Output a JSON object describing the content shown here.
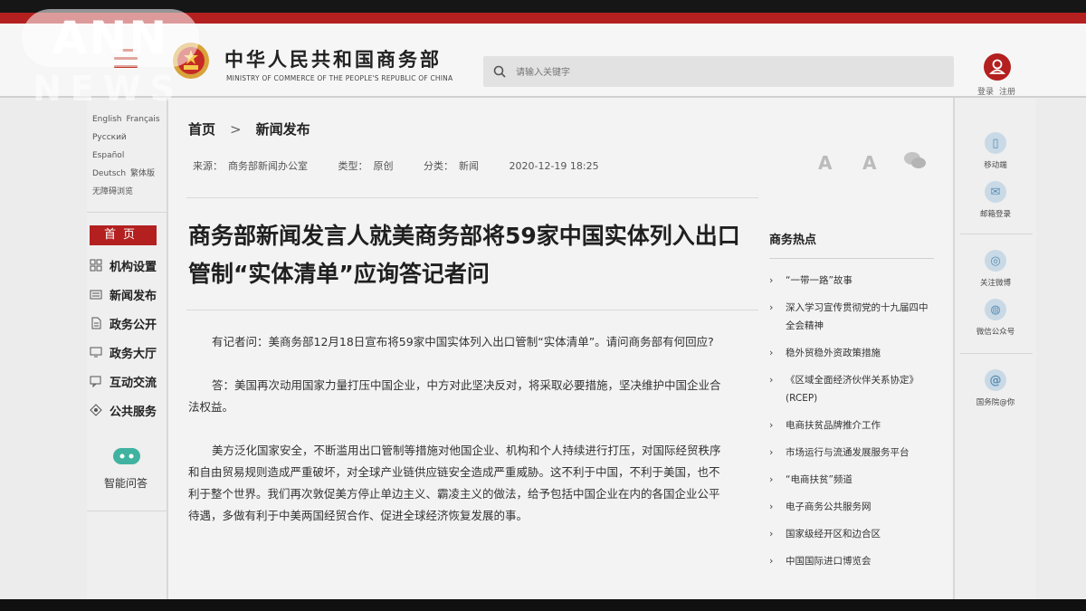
{
  "watermark": {
    "top": "ANN",
    "bottom": "NEWS"
  },
  "header": {
    "ministry_cn": "中华人民共和国商务部",
    "ministry_en": "MINISTRY OF COMMERCE OF THE PEOPLE'S REPUBLIC OF CHINA",
    "search_placeholder": "请输入关键字",
    "login": "登录",
    "register": "注册"
  },
  "left_nav": {
    "languages": [
      "English",
      "Français",
      "Русский",
      "Español",
      "Deutsch",
      "繁体版",
      "无障碍浏览"
    ],
    "home": "首页",
    "items": [
      {
        "label": "机构设置",
        "icon": "org-icon"
      },
      {
        "label": "新闻发布",
        "icon": "news-icon"
      },
      {
        "label": "政务公开",
        "icon": "document-icon"
      },
      {
        "label": "政务大厅",
        "icon": "monitor-icon"
      },
      {
        "label": "互动交流",
        "icon": "chat-icon"
      },
      {
        "label": "公共服务",
        "icon": "service-icon"
      }
    ],
    "assistant": "智能问答"
  },
  "article": {
    "breadcrumb": [
      "首页",
      "新闻发布"
    ],
    "meta": {
      "source_label": "来源：",
      "source": "商务部新闻办公室",
      "type_label": "类型：",
      "type": "原创",
      "category_label": "分类：",
      "category": "新闻",
      "datetime": "2020-12-19 18:25"
    },
    "font_large": "A",
    "font_small": "A",
    "title": "商务部新闻发言人就美商务部将59家中国实体列入出口管制“实体清单”应询答记者问",
    "paragraphs": [
      "有记者问：美商务部12月18日宣布将59家中国实体列入出口管制“实体清单”。请问商务部有何回应?",
      "答：美国再次动用国家力量打压中国企业，中方对此坚决反对，将采取必要措施，坚决维护中国企业合法权益。",
      "美方泛化国家安全，不断滥用出口管制等措施对他国企业、机构和个人持续进行打压，对国际经贸秩序和自由贸易规则造成严重破坏，对全球产业链供应链安全造成严重威胁。这不利于中国，不利于美国，也不利于整个世界。我们再次敦促美方停止单边主义、霸凌主义的做法，给予包括中国企业在内的各国企业公平待遇，多做有利于中美两国经贸合作、促进全球经济恢复发展的事。"
    ]
  },
  "hot_topics": {
    "title": "商务热点",
    "items": [
      "“一带一路”故事",
      "深入学习宣传贯彻党的十九届四中全会精神",
      "稳外贸稳外资政策措施",
      "《区域全面经济伙伴关系协定》(RCEP)",
      "电商扶贫品牌推介工作",
      "市场运行与流通发展服务平台",
      "“电商扶贫”频道",
      "电子商务公共服务网",
      "国家级经开区和边合区",
      "中国国际进口博览会"
    ]
  },
  "right_nav": {
    "items": [
      {
        "label": "移动端",
        "glyph": "▯"
      },
      {
        "label": "邮箱登录",
        "glyph": "✉"
      },
      {
        "label": "关注微博",
        "glyph": "◎"
      },
      {
        "label": "微信公众号",
        "glyph": "◍"
      },
      {
        "label": "国务院@你",
        "glyph": "@"
      }
    ]
  }
}
